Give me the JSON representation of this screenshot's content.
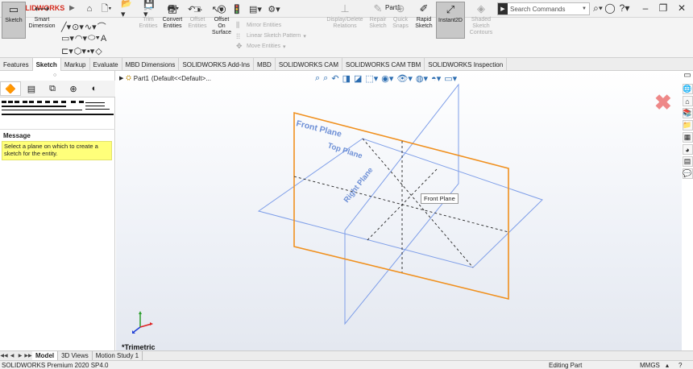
{
  "app": {
    "brand_prefix": "3S",
    "brand": "SOLIDWORKS",
    "document_title": "Part1"
  },
  "search": {
    "placeholder": "Search Commands"
  },
  "icons": {
    "quick_access": [
      "home-icon",
      "new-document-icon",
      "open-icon",
      "save-icon",
      "print-icon",
      "undo-icon",
      "select-icon",
      "rebuild-icon",
      "file-properties-icon",
      "options-icon"
    ],
    "title_right": [
      "help-icon",
      "user-icon",
      "question-icon",
      "minimize-icon",
      "restore-icon",
      "close-icon"
    ]
  },
  "commands": {
    "sketch": "Sketch",
    "smart_dimension": "Smart Dimension",
    "trim_entities": "Trim Entities",
    "convert_entities": "Convert Entities",
    "offset_entities": "Offset Entities",
    "offset_on_surface": "Offset On Surface",
    "mirror_entities": "Mirror Entities",
    "linear_sketch_pattern": "Linear Sketch Pattern",
    "move_entities": "Move Entities",
    "display_delete_relations": "Display/Delete Relations",
    "repair_sketch": "Repair Sketch",
    "quick_snaps": "Quick Snaps",
    "rapid_sketch": "Rapid Sketch",
    "instant2d": "Instant2D",
    "shaded_sketch_contours": "Shaded Sketch Contours"
  },
  "tabs": [
    "Features",
    "Sketch",
    "Markup",
    "Evaluate",
    "MBD Dimensions",
    "SOLIDWORKS Add-Ins",
    "MBD",
    "SOLIDWORKS CAM",
    "SOLIDWORKS CAM TBM",
    "SOLIDWORKS Inspection"
  ],
  "active_tab": "Sketch",
  "panel": {
    "message_title": "Message",
    "message_text": "Select a plane on which to create a sketch for the entity."
  },
  "tree": {
    "part": "Part1",
    "config": "(Default<<Default>..."
  },
  "viewport": {
    "planes": {
      "front": "Front Plane",
      "top": "Top Plane",
      "right": "Right Plane"
    },
    "tooltip": "Front Plane",
    "view_orientation": "*Trimetric",
    "front_color": "#f0901e",
    "plane_color": "#7e9ee8"
  },
  "bottom_tabs": [
    "Model",
    "3D Views",
    "Motion Study 1"
  ],
  "status": {
    "product": "SOLIDWORKS Premium 2020 SP4.0",
    "mode": "Editing Part",
    "units": "MMGS"
  }
}
